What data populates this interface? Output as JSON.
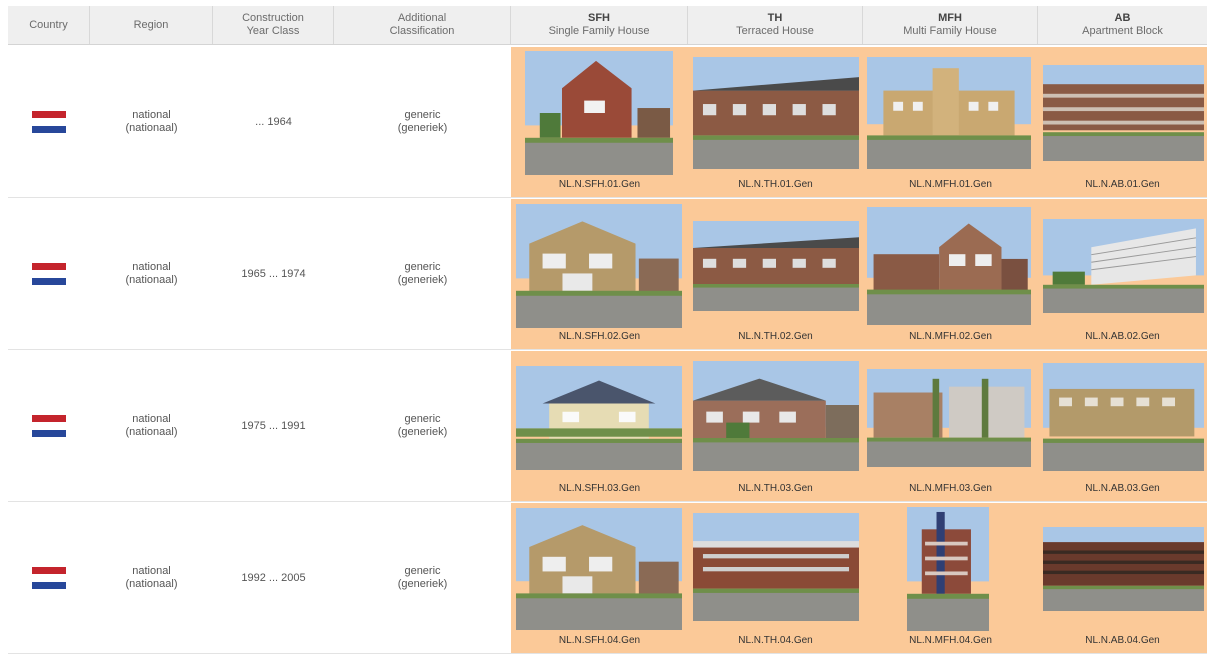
{
  "header": {
    "country": "Country",
    "region": "Region",
    "year_line1": "Construction",
    "year_line2": "Year Class",
    "class_line1": "Additional",
    "class_line2": "Classification",
    "sfh_abbr": "SFH",
    "sfh_name": "Single Family House",
    "th_abbr": "TH",
    "th_name": "Terraced House",
    "mfh_abbr": "MFH",
    "mfh_name": "Multi Family House",
    "ab_abbr": "AB",
    "ab_name": "Apartment Block"
  },
  "rows": [
    {
      "flag": "netherlands-flag-icon",
      "region1": "national",
      "region2": "(nationaal)",
      "year": "... 1964",
      "class1": "generic",
      "class2": "(generiek)",
      "codes": [
        "NL.N.SFH.01.Gen",
        "NL.N.TH.01.Gen",
        "NL.N.MFH.01.Gen",
        "NL.N.AB.01.Gen"
      ]
    },
    {
      "flag": "netherlands-flag-icon",
      "region1": "national",
      "region2": "(nationaal)",
      "year": "1965 ... 1974",
      "class1": "generic",
      "class2": "(generiek)",
      "codes": [
        "NL.N.SFH.02.Gen",
        "NL.N.TH.02.Gen",
        "NL.N.MFH.02.Gen",
        "NL.N.AB.02.Gen"
      ]
    },
    {
      "flag": "netherlands-flag-icon",
      "region1": "national",
      "region2": "(nationaal)",
      "year": "1975 ... 1991",
      "class1": "generic",
      "class2": "(generiek)",
      "codes": [
        "NL.N.SFH.03.Gen",
        "NL.N.TH.03.Gen",
        "NL.N.MFH.03.Gen",
        "NL.N.AB.03.Gen"
      ]
    },
    {
      "flag": "netherlands-flag-icon",
      "region1": "national",
      "region2": "(nationaal)",
      "year": "1992 ... 2005",
      "class1": "generic",
      "class2": "(generiek)",
      "codes": [
        "NL.N.SFH.04.Gen",
        "NL.N.TH.04.Gen",
        "NL.N.MFH.04.Gen",
        "NL.N.AB.04.Gen"
      ]
    }
  ],
  "colors": {
    "image_cell_bg": "#fbc998",
    "header_bg": "#efefef",
    "flag_red": "#c4242c",
    "flag_white": "#ffffff",
    "flag_blue": "#27479a"
  }
}
